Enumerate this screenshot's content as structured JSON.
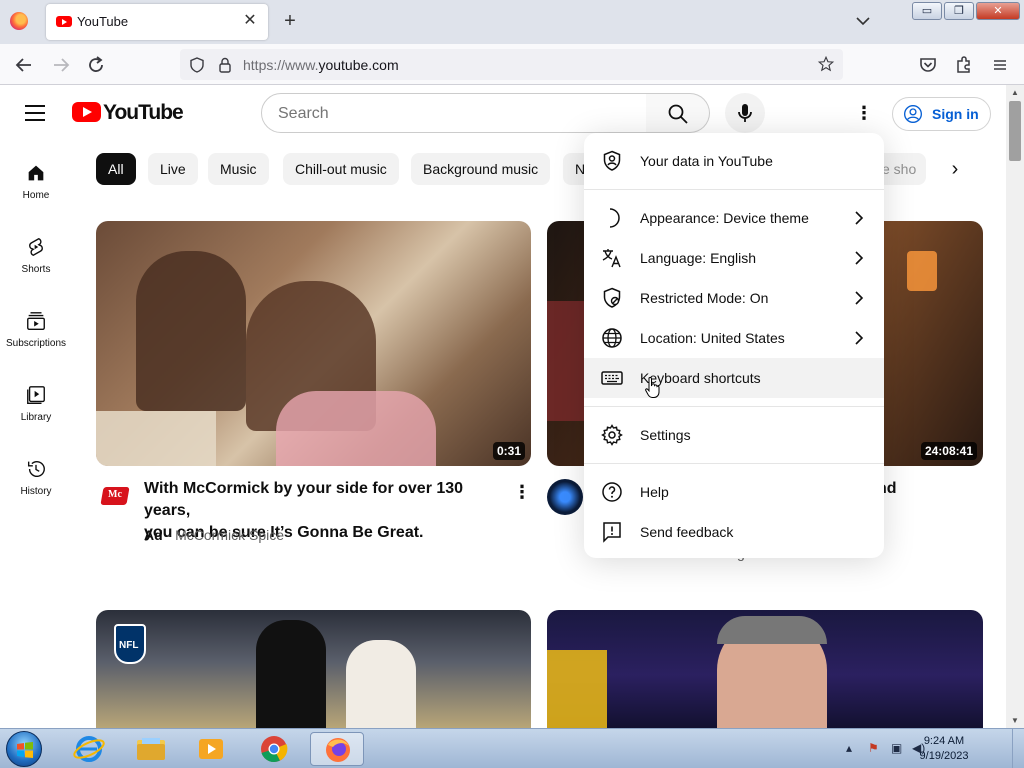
{
  "browser": {
    "tab_title": "YouTube",
    "tab_close": "✕",
    "new_tab": "+",
    "url_scheme": "https://www.",
    "url_host": "youtube.com",
    "window_buttons": {
      "minimize": "▭",
      "restore": "❐",
      "close": "✕"
    }
  },
  "header": {
    "logo_text": "YouTube",
    "search_placeholder": "Search",
    "signin_label": "Sign in"
  },
  "guide": [
    {
      "label": "Home",
      "icon": "home-icon"
    },
    {
      "label": "Shorts",
      "icon": "shorts-icon"
    },
    {
      "label": "Subscriptions",
      "icon": "subscriptions-icon"
    },
    {
      "label": "Library",
      "icon": "library-icon"
    },
    {
      "label": "History",
      "icon": "history-icon"
    }
  ],
  "chips": [
    "All",
    "Live",
    "Music",
    "Chill-out music",
    "Background music",
    "N",
    "e sho"
  ],
  "videos": [
    {
      "duration": "0:31",
      "title_line1": "With McCormick by your side for over 130 years,",
      "title_line2": "you can be sure It’s Gonna Be Great.",
      "ad_label": "Ad",
      "separator": " · ",
      "channel": "McCormick Spice"
    },
    {
      "duration": "24:08:41",
      "title_fragment": "nd",
      "meta_fragment": "g"
    }
  ],
  "menu": {
    "items": [
      {
        "label": "Your data in YouTube",
        "icon": "shield-person-icon",
        "has_submenu": false
      },
      {
        "label": "Appearance: Device theme",
        "icon": "moon-icon",
        "has_submenu": true
      },
      {
        "label": "Language: English",
        "icon": "translate-icon",
        "has_submenu": true
      },
      {
        "label": "Restricted Mode: On",
        "icon": "restricted-shield-icon",
        "has_submenu": true
      },
      {
        "label": "Location: United States",
        "icon": "globe-icon",
        "has_submenu": true
      },
      {
        "label": "Keyboard shortcuts",
        "icon": "keyboard-icon",
        "has_submenu": false
      },
      {
        "label": "Settings",
        "icon": "gear-icon",
        "has_submenu": false
      },
      {
        "label": "Help",
        "icon": "help-icon",
        "has_submenu": false
      },
      {
        "label": "Send feedback",
        "icon": "feedback-icon",
        "has_submenu": false
      }
    ]
  },
  "taskbar": {
    "time": "9:24 AM",
    "date": "9/19/2023"
  },
  "colors": {
    "youtube_red": "#ff0000",
    "signin_blue": "#065fd4",
    "chip_active": "#0f0f0f"
  }
}
